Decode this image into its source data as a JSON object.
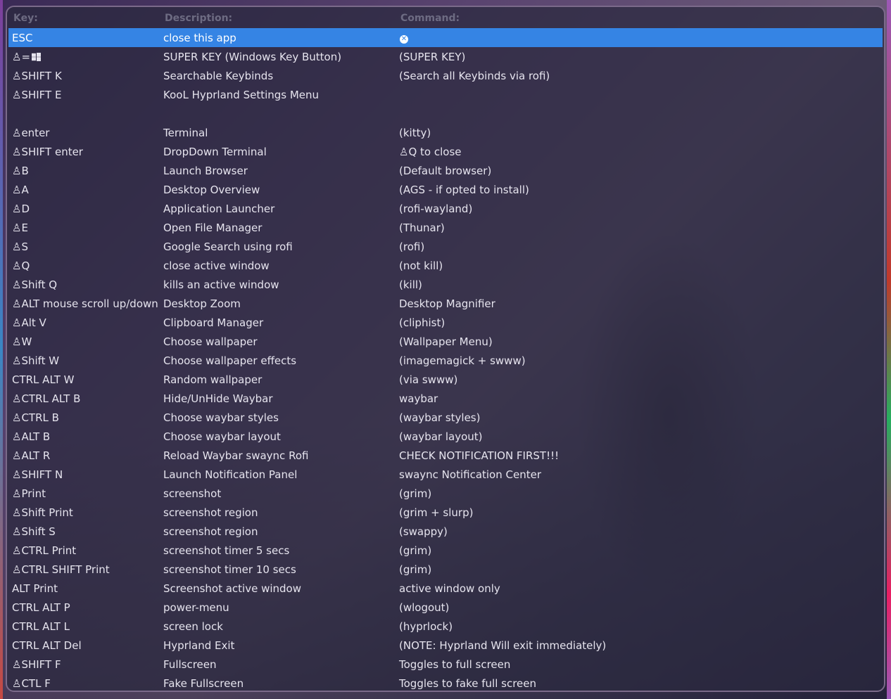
{
  "header": {
    "key": "Key:",
    "description": "Description:",
    "command": "Command:"
  },
  "rows": [
    {
      "key": "ESC",
      "desc": "close this app",
      "cmd": "",
      "selected": true,
      "icon": "close-icon"
    },
    {
      "key": "♙=",
      "desc": "SUPER KEY (Windows Key Button)",
      "cmd": "(SUPER KEY)",
      "icon": "windows-icon"
    },
    {
      "key": "♙SHIFT K",
      "desc": "Searchable Keybinds",
      "cmd": "(Search all Keybinds via rofi)"
    },
    {
      "key": "♙SHIFT E",
      "desc": "KooL Hyprland Settings Menu",
      "cmd": ""
    },
    {
      "key": "",
      "desc": "",
      "cmd": ""
    },
    {
      "key": "♙enter",
      "desc": "Terminal",
      "cmd": "(kitty)"
    },
    {
      "key": "♙SHIFT enter",
      "desc": "DropDown Terminal",
      "cmd": "♙Q to close"
    },
    {
      "key": "♙B",
      "desc": "Launch Browser",
      "cmd": "(Default browser)"
    },
    {
      "key": "♙A",
      "desc": "Desktop Overview",
      "cmd": "(AGS - if opted to install)"
    },
    {
      "key": "♙D",
      "desc": "Application Launcher",
      "cmd": "(rofi-wayland)"
    },
    {
      "key": "♙E",
      "desc": "Open File Manager",
      "cmd": "(Thunar)"
    },
    {
      "key": "♙S",
      "desc": "Google Search using rofi",
      "cmd": "(rofi)"
    },
    {
      "key": "♙Q",
      "desc": "close active window",
      "cmd": "(not kill)"
    },
    {
      "key": "♙Shift Q",
      "desc": "kills an active window",
      "cmd": "(kill)"
    },
    {
      "key": "♙ALT mouse scroll up/down",
      "desc": "Desktop Zoom",
      "cmd": "Desktop Magnifier"
    },
    {
      "key": "♙Alt V",
      "desc": "Clipboard Manager",
      "cmd": "(cliphist)"
    },
    {
      "key": "♙W",
      "desc": "Choose wallpaper",
      "cmd": "(Wallpaper Menu)"
    },
    {
      "key": "♙Shift W",
      "desc": "Choose wallpaper effects",
      "cmd": "(imagemagick + swww)"
    },
    {
      "key": "CTRL ALT W",
      "desc": "Random wallpaper",
      "cmd": "(via swww)"
    },
    {
      "key": "♙CTRL ALT B",
      "desc": "Hide/UnHide Waybar",
      "cmd": "waybar"
    },
    {
      "key": "♙CTRL B",
      "desc": "Choose waybar styles",
      "cmd": "(waybar styles)"
    },
    {
      "key": "♙ALT B",
      "desc": "Choose waybar layout",
      "cmd": "(waybar layout)"
    },
    {
      "key": "♙ALT R",
      "desc": "Reload Waybar swaync Rofi",
      "cmd": "CHECK NOTIFICATION FIRST!!!"
    },
    {
      "key": "♙SHIFT N",
      "desc": "Launch Notification Panel",
      "cmd": "swaync Notification Center"
    },
    {
      "key": "♙Print",
      "desc": "screenshot",
      "cmd": "(grim)"
    },
    {
      "key": "♙Shift Print",
      "desc": "screenshot region",
      "cmd": "(grim + slurp)"
    },
    {
      "key": "♙Shift S",
      "desc": "screenshot region",
      "cmd": "(swappy)"
    },
    {
      "key": "♙CTRL Print",
      "desc": "screenshot timer 5 secs",
      "cmd": "(grim)"
    },
    {
      "key": "♙CTRL SHIFT Print",
      "desc": "screenshot timer 10 secs",
      "cmd": "(grim)"
    },
    {
      "key": "ALT Print",
      "desc": "Screenshot active window",
      "cmd": "active window only"
    },
    {
      "key": "CTRL ALT P",
      "desc": "power-menu",
      "cmd": "(wlogout)"
    },
    {
      "key": "CTRL ALT L",
      "desc": "screen lock",
      "cmd": "(hyprlock)"
    },
    {
      "key": "CTRL ALT Del",
      "desc": "Hyprland Exit",
      "cmd": "(NOTE: Hyprland Will exit immediately)"
    },
    {
      "key": "♙SHIFT F",
      "desc": "Fullscreen",
      "cmd": "Toggles to full screen"
    },
    {
      "key": "♙CTL F",
      "desc": "Fake Fullscreen",
      "cmd": "Toggles to fake full screen"
    }
  ],
  "colors": {
    "selection": "#3584e4",
    "text": "#e6e4ee",
    "header": "#6d6b82"
  }
}
